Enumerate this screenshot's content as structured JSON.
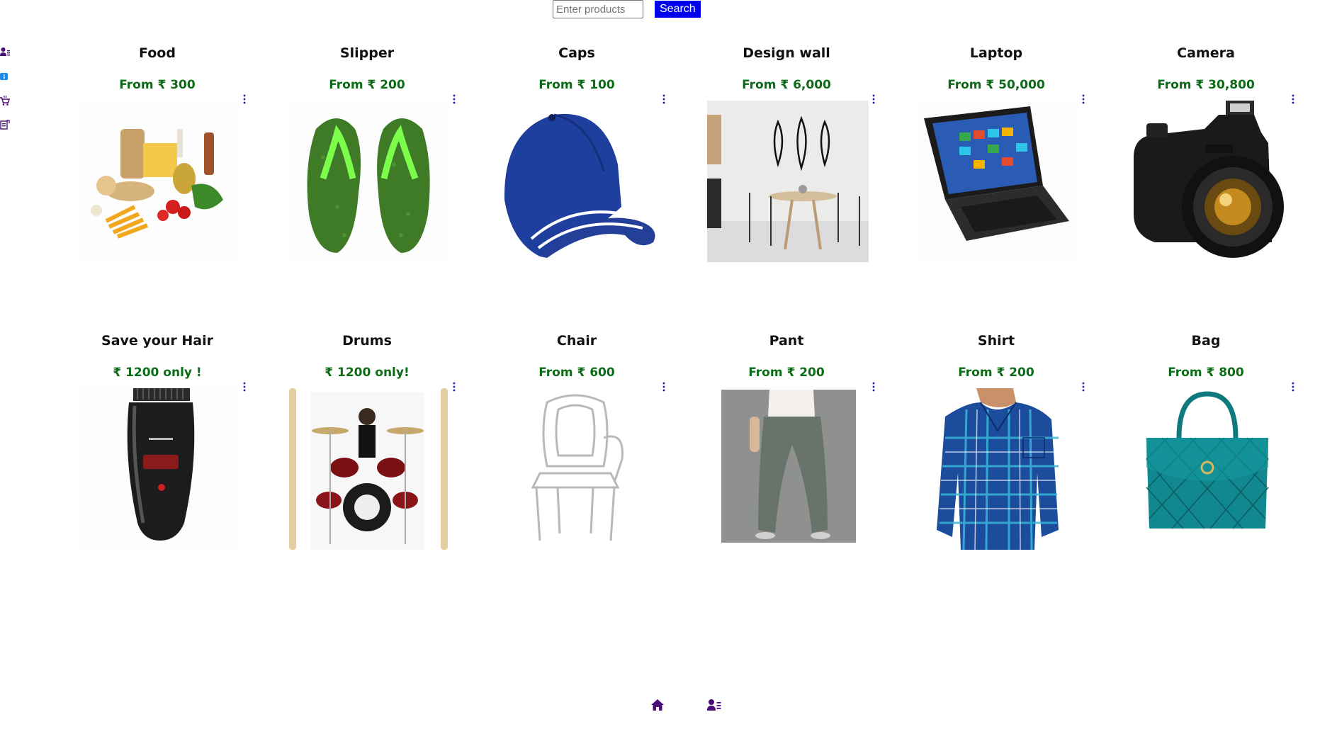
{
  "search": {
    "placeholder": "Enter products",
    "button_label": "Search"
  },
  "side_icons": [
    "user-list-icon",
    "info-icon",
    "cart-icon",
    "orders-icon"
  ],
  "products": [
    {
      "title": "Food",
      "price": "From ₹ 300",
      "image": "food-image"
    },
    {
      "title": "Slipper",
      "price": "From ₹ 200",
      "image": "slipper-image"
    },
    {
      "title": "Caps",
      "price": "From ₹ 100",
      "image": "cap-image"
    },
    {
      "title": "Design wall",
      "price": "From ₹ 6,000",
      "image": "design-wall-image"
    },
    {
      "title": "Laptop",
      "price": "From ₹ 50,000",
      "image": "laptop-image"
    },
    {
      "title": "Camera",
      "price": "From ₹ 30,800",
      "image": "camera-image"
    },
    {
      "title": "Save your Hair",
      "price": "₹ 1200 only !",
      "image": "trimmer-image"
    },
    {
      "title": "Drums",
      "price": "₹ 1200 only!",
      "image": "drums-image"
    },
    {
      "title": "Chair",
      "price": "From ₹ 600",
      "image": "chair-image"
    },
    {
      "title": "Pant",
      "price": "From ₹ 200",
      "image": "pant-image"
    },
    {
      "title": "Shirt",
      "price": "From ₹ 200",
      "image": "shirt-image"
    },
    {
      "title": "Bag",
      "price": "From ₹ 800",
      "image": "bag-image"
    }
  ],
  "bottom_nav": [
    "home-icon",
    "user-list-icon"
  ],
  "colors": {
    "icon_purple": "#4b0d7a",
    "search_blue": "#0000ee",
    "price_green": "#0b6b16"
  }
}
